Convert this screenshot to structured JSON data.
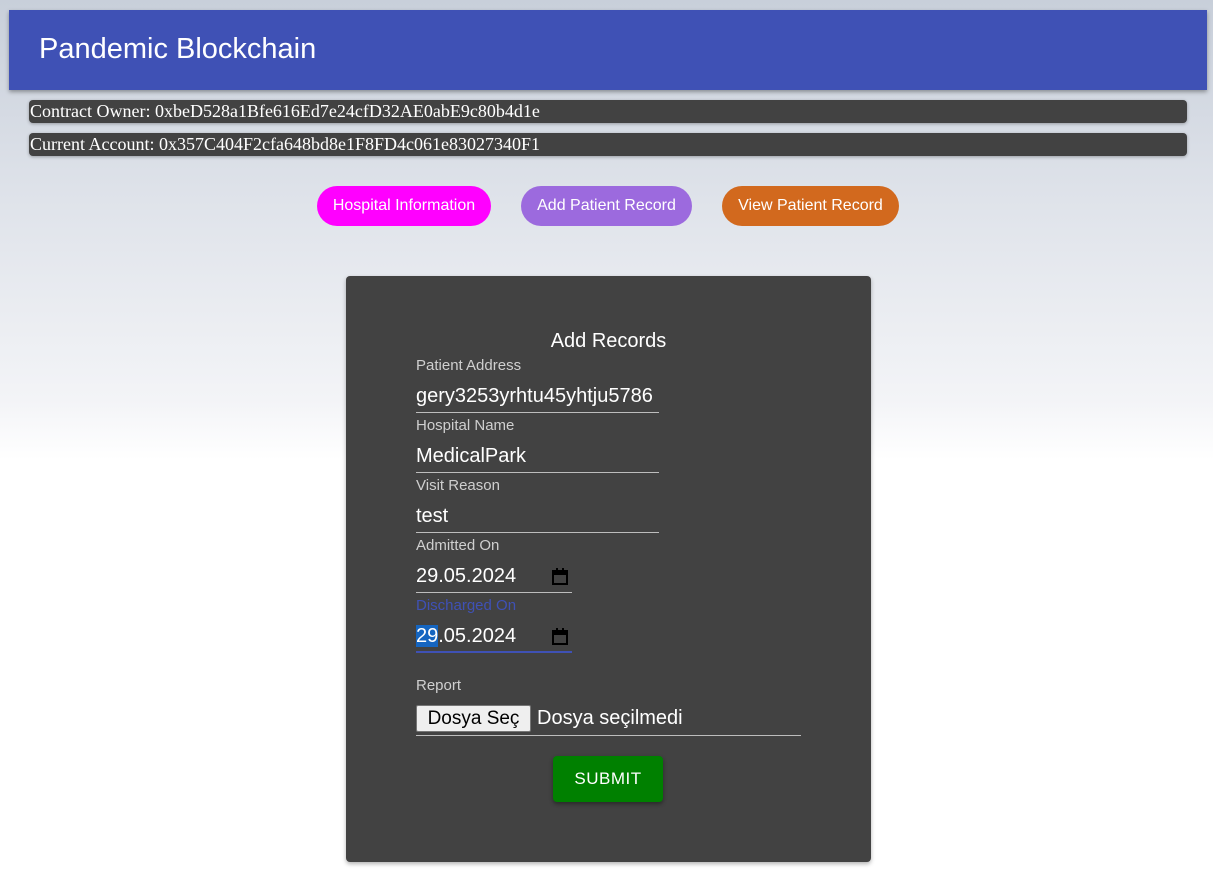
{
  "appbar": {
    "title": "Pandemic Blockchain"
  },
  "accounts": {
    "owner": "Contract Owner: 0xbeD528a1Bfe616Ed7e24cfD32AE0abE9c80b4d1e",
    "current": "Current Account: 0x357C404F2cfa648bd8e1F8FD4c061e83027340F1"
  },
  "nav": {
    "hospital_info": "Hospital Information",
    "add_patient": "Add Patient Record",
    "view_patient": "View Patient Record"
  },
  "form": {
    "title": "Add Records",
    "patient_address": {
      "label": "Patient Address",
      "value": "gery3253yrhtu45yhtju5786"
    },
    "hospital_name": {
      "label": "Hospital Name",
      "value": "MedicalPark"
    },
    "visit_reason": {
      "label": "Visit Reason",
      "value": "test"
    },
    "admitted_on": {
      "label": "Admitted On",
      "value": "29.05.2024"
    },
    "discharged_on": {
      "label": "Discharged On",
      "day": "29",
      "rest": ".05.2024"
    },
    "report": {
      "label": "Report",
      "button": "Dosya Seç",
      "status": "Dosya seçilmedi"
    },
    "submit": "SUBMIT"
  },
  "colors": {
    "appbar": "#3f51b5",
    "hospital_btn": "#ff00ff",
    "add_btn": "#9c6ade",
    "view_btn": "#d2691e",
    "submit_btn": "#008000",
    "card": "#424242"
  },
  "icons": {
    "date_picker": "calendar-icon"
  }
}
